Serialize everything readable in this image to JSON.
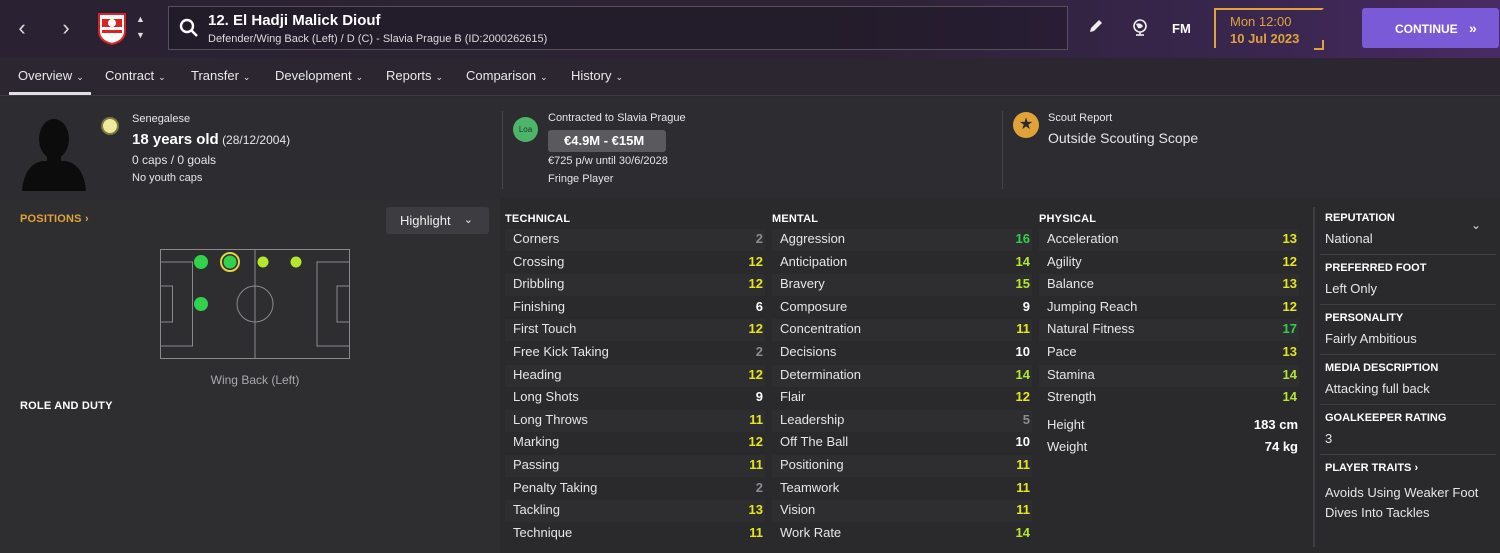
{
  "header": {
    "player_name": "12. El Hadji Malick Diouf",
    "player_sub": "Defender/Wing Back (Left) / D (C) - Slavia Prague B (ID:2000262615)",
    "brand": "FM",
    "day_time": "Mon 12:00",
    "date": "10 Jul 2023",
    "continue_label": "CONTINUE"
  },
  "tabs": [
    {
      "label": "Overview"
    },
    {
      "label": "Contract"
    },
    {
      "label": "Transfer"
    },
    {
      "label": "Development"
    },
    {
      "label": "Reports"
    },
    {
      "label": "Comparison"
    },
    {
      "label": "History"
    }
  ],
  "profile": {
    "nationality": "Senegalese",
    "age": "18 years old",
    "dob": "(28/12/2004)",
    "caps": "0 caps / 0 goals",
    "youth_caps": "No youth caps",
    "loan_badge": "Loa",
    "contract_title": "Contracted to Slavia Prague",
    "value": "€4.9M - €15M",
    "wage": "€725 p/w until 30/6/2028",
    "squad_status": "Fringe Player",
    "scout_title": "Scout Report",
    "scout_value": "Outside Scouting Scope"
  },
  "positions": {
    "heading": "POSITIONS",
    "highlight_label": "Highlight",
    "role_label": "Wing Back (Left)",
    "role_duty_heading": "ROLE AND DUTY"
  },
  "colors": {
    "accent_orange": "#e0a33a",
    "continue_purple": "#7a5ad6",
    "val_grey": "#8c8c90",
    "val_white": "#ffffff",
    "val_yellow": "#e6e61e",
    "val_lime": "#b4e62d",
    "val_green": "#2fd24a"
  },
  "technical": {
    "heading": "TECHNICAL",
    "items": [
      {
        "name": "Corners",
        "value": "2"
      },
      {
        "name": "Crossing",
        "value": "12"
      },
      {
        "name": "Dribbling",
        "value": "12"
      },
      {
        "name": "Finishing",
        "value": "6"
      },
      {
        "name": "First Touch",
        "value": "12"
      },
      {
        "name": "Free Kick Taking",
        "value": "2"
      },
      {
        "name": "Heading",
        "value": "12"
      },
      {
        "name": "Long Shots",
        "value": "9"
      },
      {
        "name": "Long Throws",
        "value": "11"
      },
      {
        "name": "Marking",
        "value": "12"
      },
      {
        "name": "Passing",
        "value": "11"
      },
      {
        "name": "Penalty Taking",
        "value": "2"
      },
      {
        "name": "Tackling",
        "value": "13"
      },
      {
        "name": "Technique",
        "value": "11"
      }
    ]
  },
  "mental": {
    "heading": "MENTAL",
    "items": [
      {
        "name": "Aggression",
        "value": "16"
      },
      {
        "name": "Anticipation",
        "value": "14"
      },
      {
        "name": "Bravery",
        "value": "15"
      },
      {
        "name": "Composure",
        "value": "9"
      },
      {
        "name": "Concentration",
        "value": "11"
      },
      {
        "name": "Decisions",
        "value": "10"
      },
      {
        "name": "Determination",
        "value": "14"
      },
      {
        "name": "Flair",
        "value": "12"
      },
      {
        "name": "Leadership",
        "value": "5"
      },
      {
        "name": "Off The Ball",
        "value": "10"
      },
      {
        "name": "Positioning",
        "value": "11"
      },
      {
        "name": "Teamwork",
        "value": "11"
      },
      {
        "name": "Vision",
        "value": "11"
      },
      {
        "name": "Work Rate",
        "value": "14"
      }
    ]
  },
  "physical": {
    "heading": "PHYSICAL",
    "items": [
      {
        "name": "Acceleration",
        "value": "13"
      },
      {
        "name": "Agility",
        "value": "12"
      },
      {
        "name": "Balance",
        "value": "13"
      },
      {
        "name": "Jumping Reach",
        "value": "12"
      },
      {
        "name": "Natural Fitness",
        "value": "17"
      },
      {
        "name": "Pace",
        "value": "13"
      },
      {
        "name": "Stamina",
        "value": "14"
      },
      {
        "name": "Strength",
        "value": "14"
      }
    ],
    "height_label": "Height",
    "height_value": "183 cm",
    "weight_label": "Weight",
    "weight_value": "74 kg"
  },
  "right_panel": {
    "reputation_title": "REPUTATION",
    "reputation": "National",
    "foot_title": "PREFERRED FOOT",
    "foot": "Left Only",
    "personality_title": "PERSONALITY",
    "personality": "Fairly Ambitious",
    "media_title": "MEDIA DESCRIPTION",
    "media": "Attacking full back",
    "gk_title": "GOALKEEPER RATING",
    "gk": "3",
    "traits_title": "PLAYER TRAITS",
    "traits": [
      "Avoids Using Weaker Foot",
      "Dives Into Tackles"
    ]
  }
}
